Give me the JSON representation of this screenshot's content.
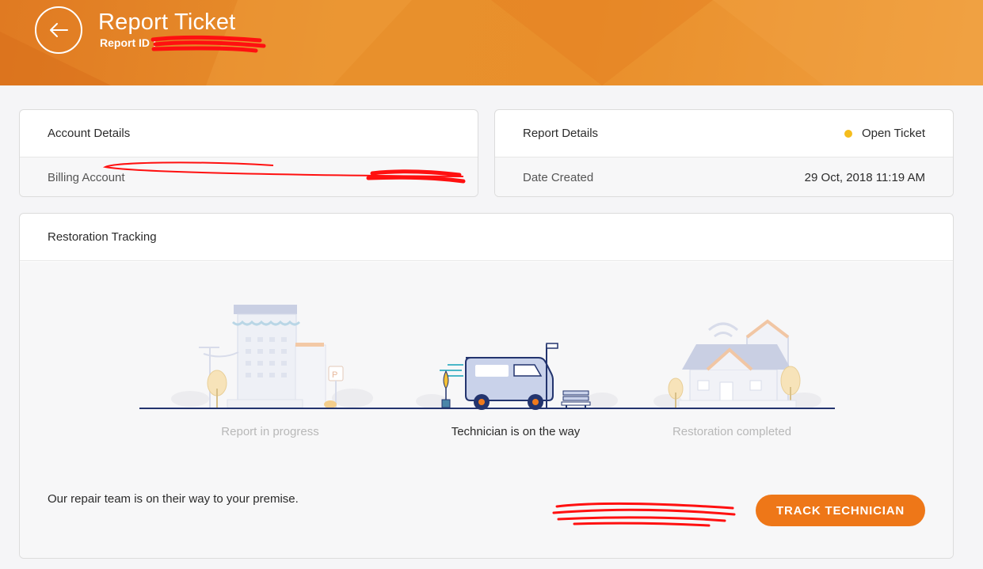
{
  "header": {
    "title": "Report Ticket",
    "report_id_label": "Report ID :"
  },
  "account_details": {
    "title": "Account Details",
    "billing_label": "Billing Account"
  },
  "report_details": {
    "title": "Report Details",
    "status": "Open Ticket",
    "status_color": "#f5bd1d",
    "date_label": "Date Created",
    "date_value": "29 Oct, 2018 11:19 AM"
  },
  "tracking": {
    "title": "Restoration Tracking",
    "steps": [
      {
        "label": "Report in progress",
        "state": "inactive"
      },
      {
        "label": "Technician is on the way",
        "state": "active"
      },
      {
        "label": "Restoration completed",
        "state": "inactive"
      }
    ],
    "message": "Our repair team is on their way to your premise.",
    "button_label": "TRACK TECHNICIAN"
  },
  "colors": {
    "accent": "#ee7718",
    "header": "#e8902c",
    "illustration": "#b9c3dd",
    "illustration_dark": "#23346e"
  }
}
